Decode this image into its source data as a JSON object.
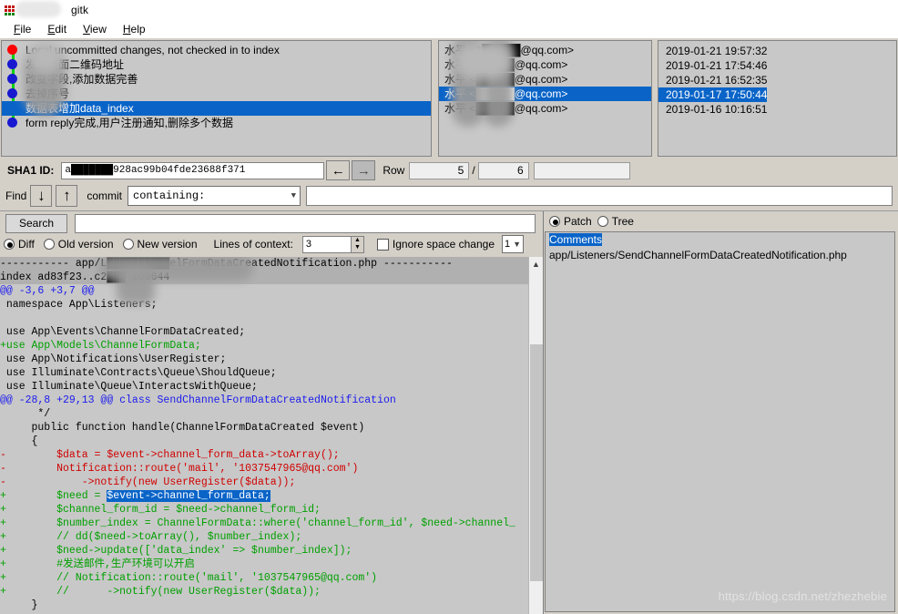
{
  "window": {
    "title": "gitk",
    "icon": "gitk-icon"
  },
  "menubar": {
    "items": [
      {
        "label": "File",
        "accel": "F"
      },
      {
        "label": "Edit",
        "accel": "E"
      },
      {
        "label": "View",
        "accel": "V"
      },
      {
        "label": "Help",
        "accel": "H"
      }
    ]
  },
  "commits": {
    "rows": [
      {
        "node": "red",
        "subject": "Local uncommitted changes, not checked in to index",
        "author": "水平 <1█████@qq.com>",
        "date": "2019-01-21 19:57:32",
        "selected": false,
        "redacted": true
      },
      {
        "node": "blue",
        "subject": "发送页面二维码地址",
        "author": "水平 <█████@qq.com>",
        "date": "2019-01-21 17:54:46",
        "selected": false,
        "redacted": true
      },
      {
        "node": "blue",
        "subject": "改变字段,添加数据完善",
        "author": "水平 <█████@qq.com>",
        "date": "2019-01-21 16:52:35",
        "selected": false,
        "redacted": true
      },
      {
        "node": "blue",
        "subject": "去掉序号",
        "author": "水平 <█████@qq.com>",
        "date": "2019-01-21 16:52:35",
        "selected": false,
        "redacted": true
      },
      {
        "node": "blue",
        "subject": "数据表增加data_index",
        "author": "水平 <█████@qq.com>",
        "date": "2019-01-17 17:50:44",
        "selected": true,
        "redacted": true
      },
      {
        "node": "blue",
        "subject": "form reply完成,用户注册通知,删除多个数据",
        "author": "水平 <█████@qq.com>",
        "date": "2019-01-16 10:16:51",
        "selected": false,
        "redacted": true
      }
    ]
  },
  "sha_row": {
    "label": "SHA1 ID:",
    "value": "a███████928ac99b04fde23688f371",
    "prev_icon": "arrow-left-icon",
    "next_icon": "arrow-right-icon",
    "row_label": "Row",
    "row_current": "5",
    "row_separator": "/",
    "row_total": "6",
    "extra_value": ""
  },
  "find_row": {
    "label": "Find",
    "down_icon": "arrow-down-icon",
    "up_icon": "arrow-up-icon",
    "scope_label": "commit",
    "mode_value": "containing:",
    "mode_chevron": "chevron-down-icon",
    "query": ""
  },
  "search_row": {
    "button_label": "Search",
    "query": ""
  },
  "options_row": {
    "diff_label": "Diff",
    "old_version_label": "Old version",
    "new_version_label": "New version",
    "selected_mode": "Diff",
    "context_label": "Lines of context:",
    "context_value": "3",
    "ignore_space_label": "Ignore space change",
    "ignore_space_checked": false,
    "encoding_value": "1",
    "encoding_chevron": "chevron-down-icon"
  },
  "right_pane": {
    "patch_label": "Patch",
    "tree_label": "Tree",
    "selected_view": "Patch",
    "files": [
      {
        "label": "Comments",
        "highlighted": true
      },
      {
        "label": "app/Listeners/SendChannelFormDataCreatedNotification.php",
        "highlighted": false
      }
    ]
  },
  "diff": {
    "lines": [
      {
        "kind": "hdr",
        "text": "----------- app/L██████████elFormDataCreatedNotification.php -----------"
      },
      {
        "kind": "hdr",
        "text": "index ad83f23..c2███ 100644"
      },
      {
        "kind": "hunk",
        "text": "@@ -3,6 +3,7 @@"
      },
      {
        "kind": "ctx",
        "text": " namespace App\\Listeners;"
      },
      {
        "kind": "ctx",
        "text": ""
      },
      {
        "kind": "ctx",
        "text": " use App\\Events\\ChannelFormDataCreated;"
      },
      {
        "kind": "add",
        "text": "+use App\\Models\\ChannelFormData;"
      },
      {
        "kind": "ctx",
        "text": " use App\\Notifications\\UserRegister;"
      },
      {
        "kind": "ctx",
        "text": " use Illuminate\\Contracts\\Queue\\ShouldQueue;"
      },
      {
        "kind": "ctx",
        "text": " use Illuminate\\Queue\\InteractsWithQueue;"
      },
      {
        "kind": "hunk",
        "text": "@@ -28,8 +29,13 @@ class SendChannelFormDataCreatedNotification"
      },
      {
        "kind": "ctx",
        "text": "      */"
      },
      {
        "kind": "ctx",
        "text": "     public function handle(ChannelFormDataCreated $event)"
      },
      {
        "kind": "ctx",
        "text": "     {"
      },
      {
        "kind": "del",
        "text": "-        $data = $event->channel_form_data->toArray();"
      },
      {
        "kind": "del",
        "text": "-        Notification::route('mail', '1037547965@qq.com')"
      },
      {
        "kind": "del",
        "text": "-            ->notify(new UserRegister($data));"
      },
      {
        "kind": "add",
        "text": "+        $need = ",
        "highlight": "$event->channel_form_data;"
      },
      {
        "kind": "add",
        "text": "+        $channel_form_id = $need->channel_form_id;"
      },
      {
        "kind": "add",
        "text": "+        $number_index = ChannelFormData::where('channel_form_id', $need->channel_"
      },
      {
        "kind": "add",
        "text": "+        // dd($need->toArray(), $number_index);"
      },
      {
        "kind": "add",
        "text": "+        $need->update(['data_index' => $number_index]);"
      },
      {
        "kind": "add",
        "text": "+        #发送邮件,生产环境可以开启"
      },
      {
        "kind": "add",
        "text": "+        // Notification::route('mail', '1037547965@qq.com')"
      },
      {
        "kind": "add",
        "text": "+        //      ->notify(new UserRegister($data));"
      },
      {
        "kind": "ctx",
        "text": "     }"
      }
    ]
  },
  "watermark": {
    "text": "https://blog.csdn.net/zhezhebie"
  },
  "colors": {
    "selection": "#0a64c8",
    "add": "#00a000",
    "del": "#d00000",
    "hunk": "#1a1aee",
    "graph_line": "#00d000",
    "node_head": "#ff0000",
    "node_commit": "#1818d0",
    "panel_bg": "#c8c8c8",
    "chrome_bg": "#d4d0c8"
  }
}
